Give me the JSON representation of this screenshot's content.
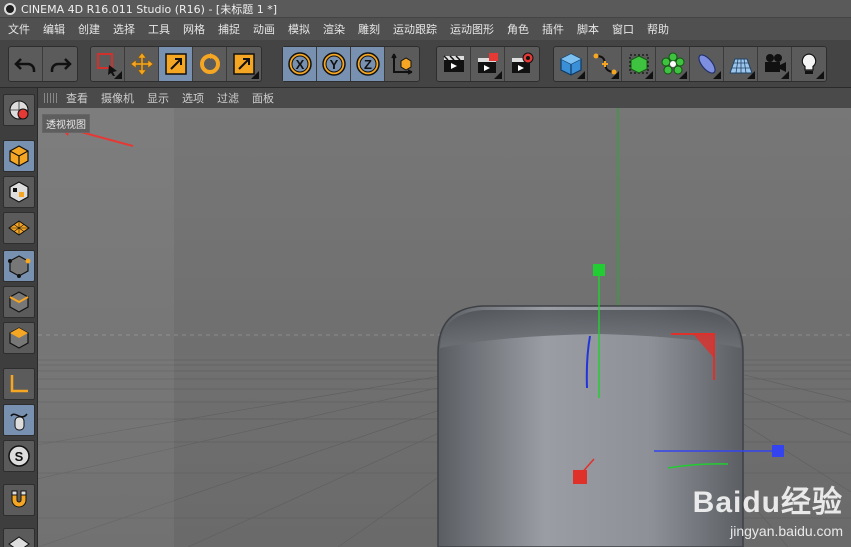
{
  "window": {
    "title": "CINEMA 4D R16.011 Studio (R16) - [未标题 1 *]"
  },
  "menubar": {
    "items": [
      "文件",
      "编辑",
      "创建",
      "选择",
      "工具",
      "网格",
      "捕捉",
      "动画",
      "模拟",
      "渲染",
      "雕刻",
      "运动跟踪",
      "运动图形",
      "角色",
      "插件",
      "脚本",
      "窗口",
      "帮助"
    ]
  },
  "toolbar": {
    "icons": [
      "undo-icon",
      "redo-icon",
      "live-selection-icon",
      "move-icon",
      "scale-icon",
      "rotate-icon",
      "recent-tool-icon",
      "x-axis-lock-icon",
      "y-axis-lock-icon",
      "z-axis-lock-icon",
      "coordinate-system-icon",
      "render-view-icon",
      "render-picture-viewer-icon",
      "render-settings-icon",
      "cube-icon",
      "spline-icon",
      "subdivision-icon",
      "cloner-icon",
      "deformer-icon",
      "floor-icon",
      "camera-icon",
      "light-icon"
    ],
    "axis_labels": {
      "x": "X",
      "y": "Y",
      "z": "Z"
    }
  },
  "viewport_menu": {
    "items": [
      "查看",
      "摄像机",
      "显示",
      "选项",
      "过滤",
      "面板"
    ]
  },
  "viewport": {
    "label": "透视视图"
  },
  "colors": {
    "accent": "#7891b0",
    "orange": "#f5a623",
    "annotation_arrow": "#e53935",
    "x_axis": "#e0302a",
    "y_axis": "#22cc33",
    "z_axis": "#3344ee"
  },
  "watermark": {
    "logo": "Baidu经验",
    "url": "jingyan.baidu.com"
  }
}
